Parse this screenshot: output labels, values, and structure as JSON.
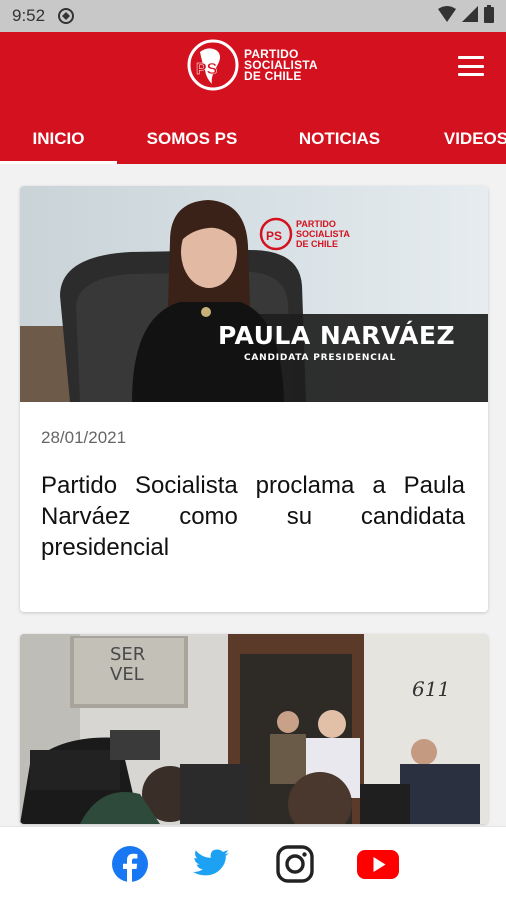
{
  "status_bar": {
    "time": "9:52"
  },
  "brand": {
    "line1": "PARTIDO",
    "line2": "SOCIALISTA",
    "line3": "DE CHILE",
    "logo_letters": "PS",
    "color": "#d4111e"
  },
  "tabs": [
    {
      "label": "INICIO",
      "active": true
    },
    {
      "label": "SOMOS PS",
      "active": false
    },
    {
      "label": "NOTICIAS",
      "active": false
    },
    {
      "label": "VIDEOS",
      "active": false
    }
  ],
  "articles": [
    {
      "image_overlay": {
        "name": "PAULA NARVÁEZ",
        "subtitle": "CANDIDATA PRESIDENCIAL",
        "logo_line1": "PARTIDO",
        "logo_line2": "SOCIALISTA",
        "logo_line3": "DE CHILE"
      },
      "date": "28/01/2021",
      "title": "Partido Socialista proclama a Paula Narváez como su candidata presidencial"
    },
    {
      "image_overlay": {
        "sign1": "SER",
        "sign2": "VEL",
        "door_number": "611"
      }
    }
  ],
  "social": [
    "facebook-icon",
    "twitter-icon",
    "instagram-icon",
    "youtube-icon"
  ]
}
